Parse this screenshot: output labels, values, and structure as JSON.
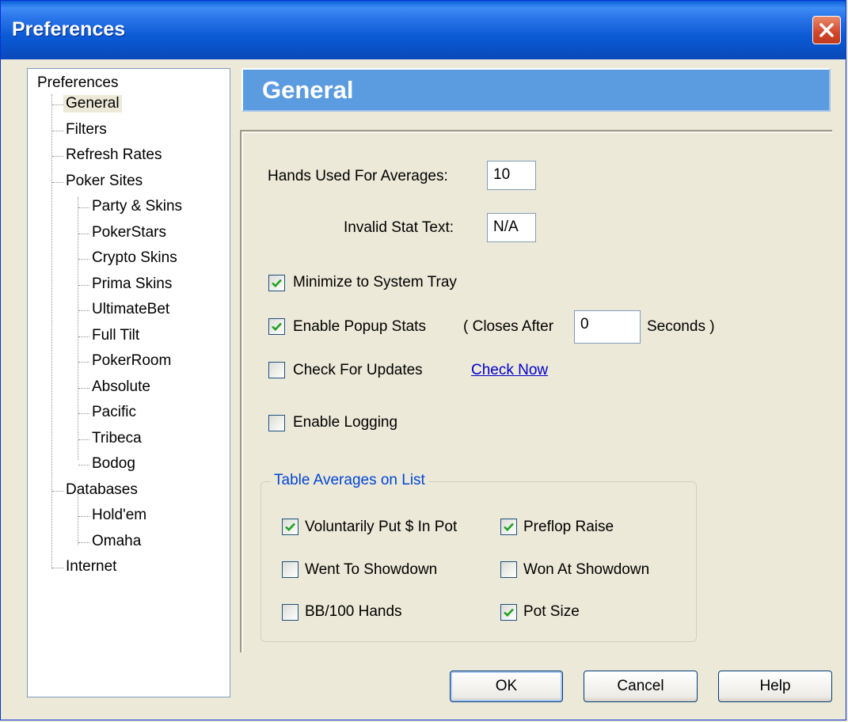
{
  "window": {
    "title": "Preferences"
  },
  "tree": {
    "root": "Preferences",
    "items": [
      {
        "label": "General",
        "level": 1,
        "selected": true
      },
      {
        "label": "Filters",
        "level": 1
      },
      {
        "label": "Refresh Rates",
        "level": 1
      },
      {
        "label": "Poker Sites",
        "level": 1
      },
      {
        "label": "Party & Skins",
        "level": 2
      },
      {
        "label": "PokerStars",
        "level": 2
      },
      {
        "label": "Crypto Skins",
        "level": 2
      },
      {
        "label": "Prima Skins",
        "level": 2
      },
      {
        "label": "UltimateBet",
        "level": 2
      },
      {
        "label": "Full Tilt",
        "level": 2
      },
      {
        "label": "PokerRoom",
        "level": 2
      },
      {
        "label": "Absolute",
        "level": 2
      },
      {
        "label": "Pacific",
        "level": 2
      },
      {
        "label": "Tribeca",
        "level": 2
      },
      {
        "label": "Bodog",
        "level": 2
      },
      {
        "label": "Databases",
        "level": 1
      },
      {
        "label": "Hold'em",
        "level": 2
      },
      {
        "label": "Omaha",
        "level": 2
      },
      {
        "label": "Internet",
        "level": 1
      }
    ]
  },
  "header": {
    "title": "General"
  },
  "general": {
    "hands_label": "Hands Used For Averages:",
    "hands_value": "10",
    "invalid_label": "Invalid Stat Text:",
    "invalid_value": "N/A",
    "minimize_label": "Minimize to System Tray",
    "minimize_checked": true,
    "popup_label": "Enable Popup Stats",
    "popup_checked": true,
    "closes_after_label": "( Closes After",
    "closes_after_value": "0",
    "seconds_label": "Seconds )",
    "updates_label": "Check For Updates",
    "updates_checked": false,
    "check_now_link": "Check Now",
    "logging_label": "Enable Logging",
    "logging_checked": false
  },
  "table_averages": {
    "legend": "Table Averages on List",
    "vpip_label": "Voluntarily Put $ In Pot",
    "vpip_checked": true,
    "pfr_label": "Preflop Raise",
    "pfr_checked": true,
    "wtsd_label": "Went To Showdown",
    "wtsd_checked": false,
    "wsd_label": "Won At Showdown",
    "wsd_checked": false,
    "bb100_label": "BB/100 Hands",
    "bb100_checked": false,
    "potsize_label": "Pot Size",
    "potsize_checked": true
  },
  "buttons": {
    "ok": "OK",
    "cancel": "Cancel",
    "help": "Help"
  }
}
